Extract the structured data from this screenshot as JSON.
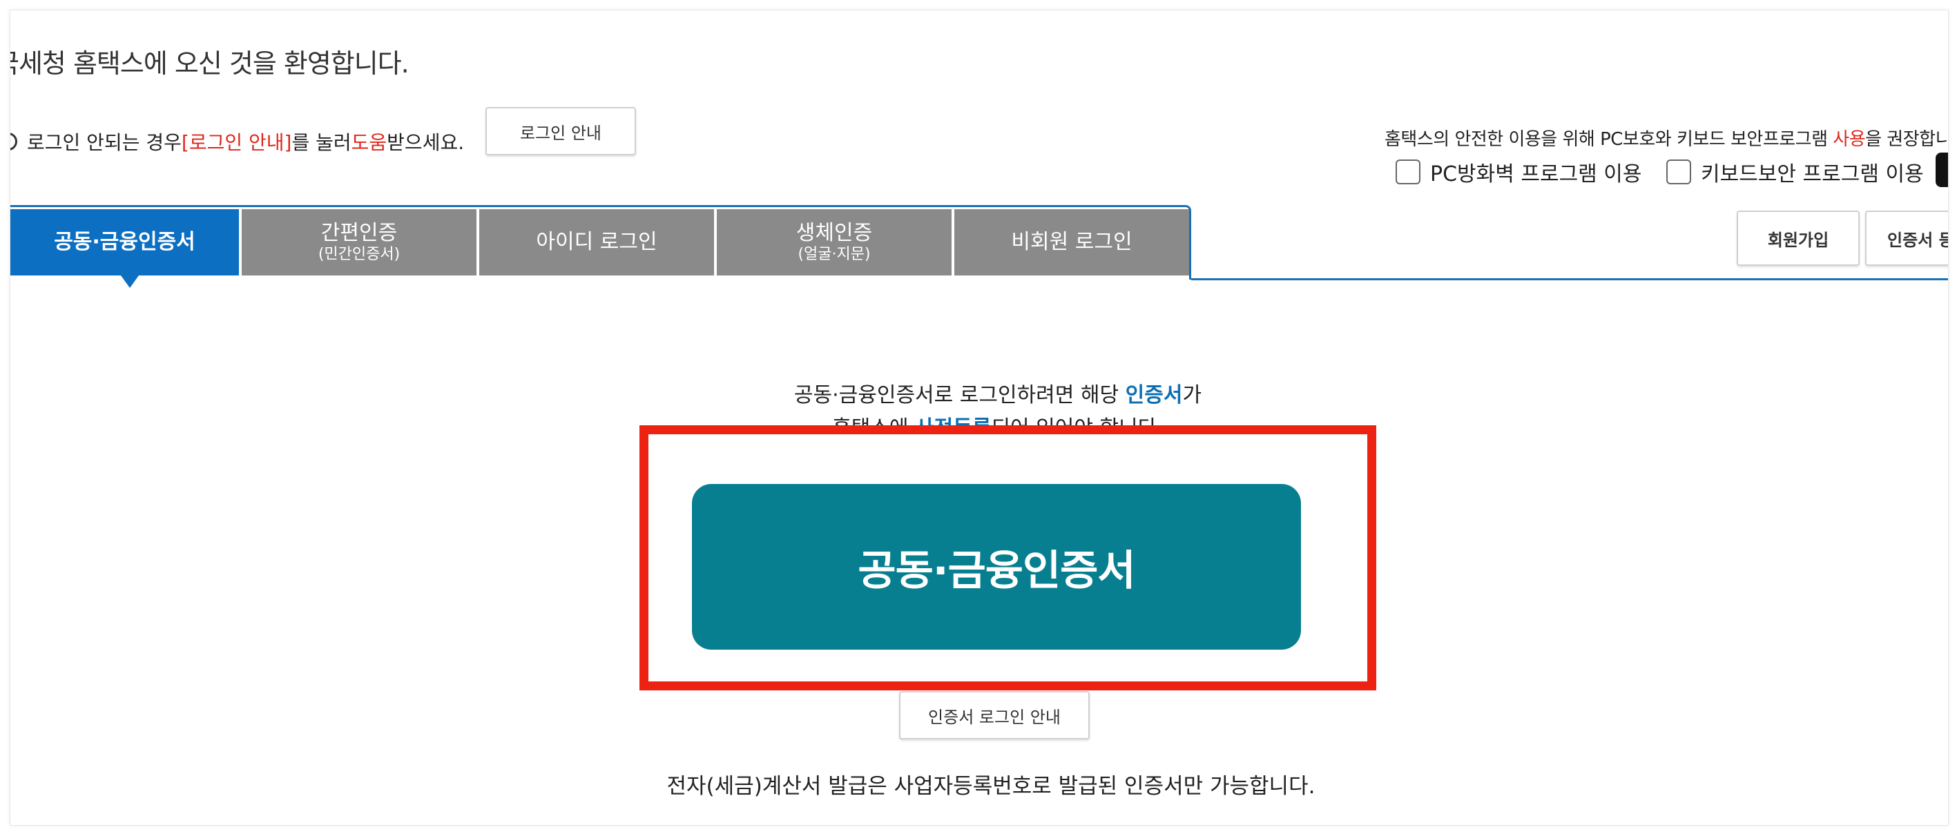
{
  "header": {
    "welcome": "국세청 홈택스에 오신 것을 환영합니다."
  },
  "notice": {
    "part1": "로그인 안되는 경우 ",
    "link": "[로그인 안내]",
    "part2": "를 눌러 ",
    "help": "도움",
    "part3": "받으세요.",
    "button_label": "로그인 안내"
  },
  "security": {
    "text_prefix": "홈택스의 안전한 이용을 위해 PC보호와 키보드 보안프로그램 ",
    "text_highlight": "사용",
    "text_suffix": "을 권장합니다.",
    "checkbox_firewall": "PC방화벽 프로그램 이용",
    "checkbox_keyboard": "키보드보안 프로그램 이용"
  },
  "tabs": [
    {
      "label": "공동·금융인증서",
      "sub": "",
      "active": true
    },
    {
      "label": "간편인증",
      "sub": "(민간인증서)",
      "active": false
    },
    {
      "label": "아이디 로그인",
      "sub": "",
      "active": false
    },
    {
      "label": "생체인증",
      "sub": "(얼굴·지문)",
      "active": false
    },
    {
      "label": "비회원 로그인",
      "sub": "",
      "active": false
    }
  ],
  "right_buttons": {
    "signup": "회원가입",
    "cert_register": "인증서 등록"
  },
  "content": {
    "desc1_prefix": "공동·금융인증서로 로그인하려면 해당 ",
    "desc1_highlight": "인증서",
    "desc1_suffix": "가",
    "desc2_prefix": "홈택스에 ",
    "desc2_highlight": "사전등록",
    "desc2_suffix": "되어 있어야 합니다.",
    "main_button": "공동·금융인증서",
    "guide_button": "인증서 로그인 안내",
    "bottom_note": "전자(세금)계산서 발급은 사업자등록번호로 발급된 인증서만 가능합니다."
  },
  "colors": {
    "tab_active": "#0c6fc2",
    "tab_inactive": "#8a8a8a",
    "main_button": "#077f90",
    "highlight_red": "#e0261b",
    "highlight_blue": "#0c6fb5",
    "annotation_box": "#ee2213"
  }
}
